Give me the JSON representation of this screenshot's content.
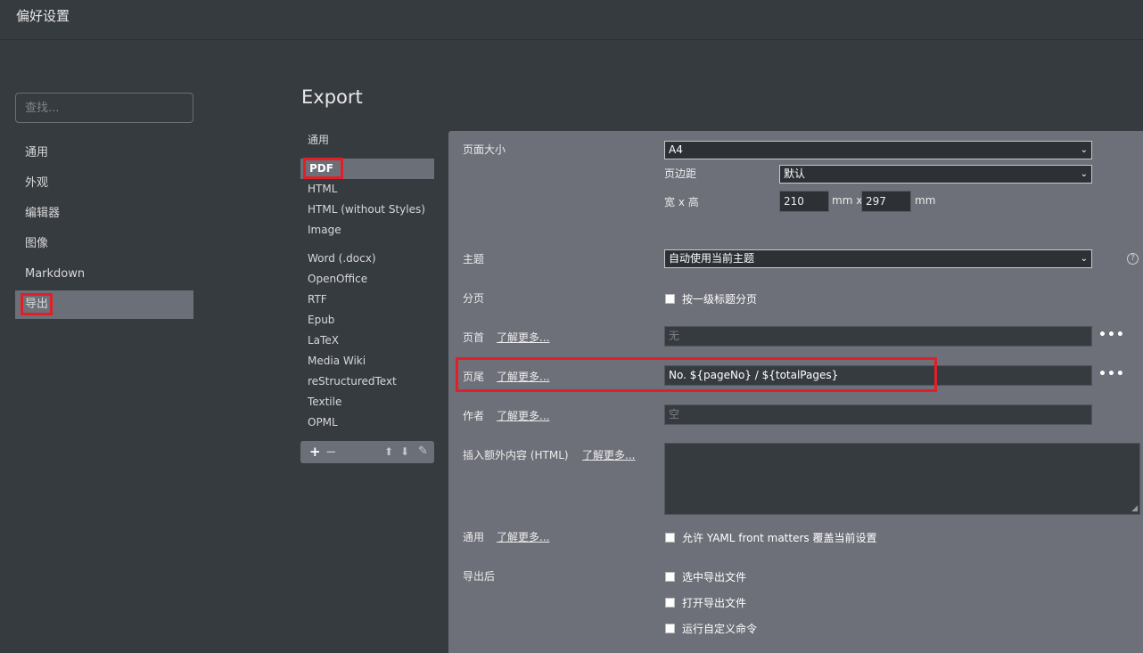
{
  "window": {
    "title": "偏好设置"
  },
  "sidebar": {
    "search_placeholder": "查找...",
    "items": [
      {
        "label": "通用"
      },
      {
        "label": "外观"
      },
      {
        "label": "编辑器"
      },
      {
        "label": "图像"
      },
      {
        "label": "Markdown"
      },
      {
        "label": "导出",
        "active": true
      }
    ]
  },
  "main": {
    "title": "Export",
    "formats": [
      {
        "label": "通用"
      },
      {
        "label": "PDF",
        "active": true
      },
      {
        "label": "HTML"
      },
      {
        "label": "HTML (without Styles)"
      },
      {
        "label": "Image"
      },
      {
        "label": "Word (.docx)"
      },
      {
        "label": "OpenOffice"
      },
      {
        "label": "RTF"
      },
      {
        "label": "Epub"
      },
      {
        "label": "LaTeX"
      },
      {
        "label": "Media Wiki"
      },
      {
        "label": "reStructuredText"
      },
      {
        "label": "Textile"
      },
      {
        "label": "OPML"
      }
    ],
    "toolbar": {
      "add": "+",
      "remove": "−",
      "up": "⬆",
      "down": "⬇",
      "edit": "✎"
    }
  },
  "settings": {
    "page_size": {
      "label": "页面大小",
      "value": "A4"
    },
    "margin": {
      "label": "页边距",
      "value": "默认"
    },
    "dimensions": {
      "label": "宽 x 高",
      "width": "210",
      "height": "297",
      "unit1": "mm x",
      "unit2": "mm"
    },
    "theme": {
      "label": "主题",
      "value": "自动使用当前主题"
    },
    "paging": {
      "label": "分页",
      "option": "按一级标题分页"
    },
    "header": {
      "label": "页首",
      "link": "了解更多...",
      "placeholder": "无"
    },
    "footer": {
      "label": "页尾",
      "link": "了解更多...",
      "value": "No. ${pageNo} / ${totalPages}"
    },
    "author": {
      "label": "作者",
      "link": "了解更多...",
      "placeholder": "空"
    },
    "extra_html": {
      "label": "插入额外内容 (HTML)",
      "link": "了解更多..."
    },
    "general": {
      "label": "通用",
      "link": "了解更多...",
      "option": "允许 YAML front matters 覆盖当前设置"
    },
    "after_export": {
      "label": "导出后",
      "options": [
        "选中导出文件",
        "打开导出文件",
        "运行自定义命令"
      ]
    },
    "more_icon": "•••",
    "help_icon": "?",
    "chevron_icon": "⌄"
  },
  "colors": {
    "highlight": "#e01f28",
    "panel": "#6e7079",
    "background": "#363b40"
  }
}
